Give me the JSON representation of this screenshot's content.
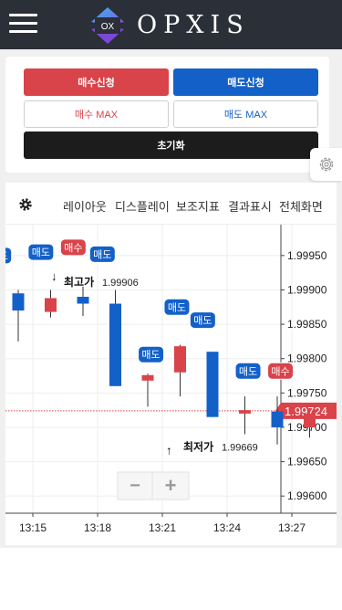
{
  "app": {
    "logo_badge": "OX",
    "logo_text": "OPXIS"
  },
  "order": {
    "buy_label": "매수신청",
    "sell_label": "매도신청",
    "buy_max_label": "매수 MAX",
    "sell_max_label": "매도 MAX",
    "reset_label": "초기화"
  },
  "toolbar": {
    "layout": "레이아웃",
    "display": "디스플레이",
    "indicators": "보조지표",
    "results": "결과표시",
    "fullscreen": "전체화면"
  },
  "colors": {
    "up": "#d9434a",
    "down": "#1360c9",
    "header": "#2b2f38"
  },
  "chart_data": {
    "type": "candlestick",
    "x_ticks": [
      "13:15",
      "13:18",
      "13:21",
      "13:24",
      "13:27"
    ],
    "y_ticks": [
      "1.99950",
      "1.99900",
      "1.99850",
      "1.99800",
      "1.99750",
      "1.99700",
      "1.99650",
      "1.99600"
    ],
    "ylim": [
      1.99575,
      1.99995
    ],
    "candles": [
      {
        "t": 0.0,
        "o": 1.99895,
        "h": 1.999,
        "l": 1.99825,
        "c": 1.9987
      },
      {
        "t": 0.5,
        "o": 1.99868,
        "h": 1.999,
        "l": 1.9986,
        "c": 1.99888
      },
      {
        "t": 1.0,
        "o": 1.9989,
        "h": 1.99905,
        "l": 1.99862,
        "c": 1.9988
      },
      {
        "t": 1.5,
        "o": 1.9988,
        "h": 1.999,
        "l": 1.9976,
        "c": 1.9976
      },
      {
        "t": 2.0,
        "o": 1.99768,
        "h": 1.99778,
        "l": 1.9973,
        "c": 1.99776
      },
      {
        "t": 2.5,
        "o": 1.9978,
        "h": 1.9982,
        "l": 1.99745,
        "c": 1.99818
      },
      {
        "t": 3.0,
        "o": 1.9981,
        "h": 1.9981,
        "l": 1.99715,
        "c": 1.99715
      },
      {
        "t": 3.5,
        "o": 1.9972,
        "h": 1.99745,
        "l": 1.9969,
        "c": 1.99725
      },
      {
        "t": 4.0,
        "o": 1.99723,
        "h": 1.99745,
        "l": 1.99675,
        "c": 1.997
      },
      {
        "t": 4.5,
        "o": 1.997,
        "h": 1.9972,
        "l": 1.99685,
        "c": 1.9972
      }
    ],
    "current_price": "1.99724",
    "current_value": 1.99724,
    "high_label": "최고가",
    "high_value": "1.99906",
    "low_label": "최저가",
    "low_value": "1.99669",
    "markers": [
      {
        "text": "매도",
        "side": "sell",
        "t": -0.3,
        "v": 1.9995
      },
      {
        "text": "매도",
        "side": "sell",
        "t": 0.35,
        "v": 1.99955
      },
      {
        "text": "매수",
        "side": "buy",
        "t": 0.85,
        "v": 1.99962
      },
      {
        "text": "매도",
        "side": "sell",
        "t": 1.3,
        "v": 1.99952
      },
      {
        "text": "매도",
        "side": "sell",
        "t": 2.45,
        "v": 1.99875
      },
      {
        "text": "매도",
        "side": "sell",
        "t": 2.85,
        "v": 1.99856
      },
      {
        "text": "매도",
        "side": "sell",
        "t": 2.05,
        "v": 1.99806
      },
      {
        "text": "매도",
        "side": "sell",
        "t": 3.55,
        "v": 1.99782
      },
      {
        "text": "매수",
        "side": "buy",
        "t": 4.05,
        "v": 1.99782
      }
    ]
  },
  "zoom": {
    "minus": "−",
    "plus": "+"
  }
}
